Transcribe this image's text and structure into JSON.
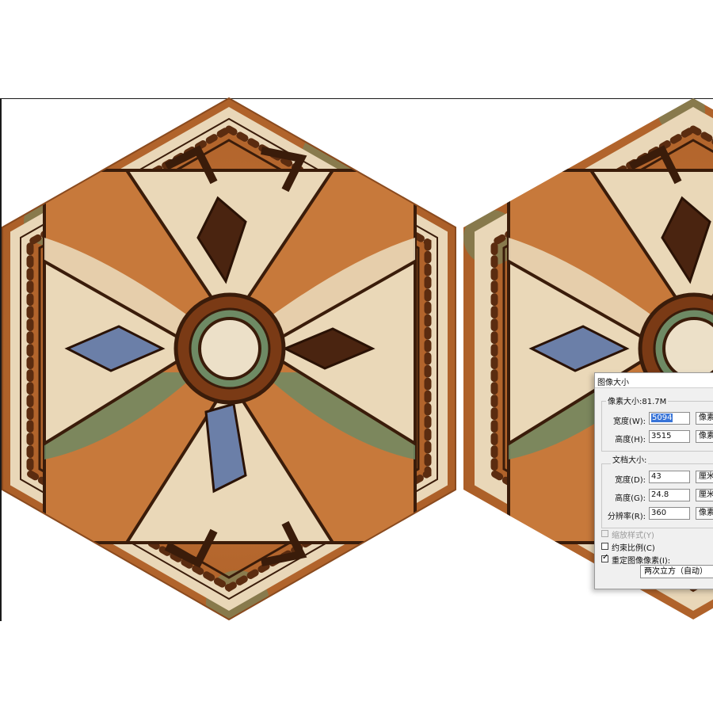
{
  "dialog": {
    "title": "图像大小",
    "pixel_dimensions": {
      "label": "像素大小:81.7M",
      "width_label": "宽度(W):",
      "width_value": "5094",
      "width_unit": "像素",
      "height_label": "高度(H):",
      "height_value": "3515",
      "height_unit": "像素"
    },
    "document_size": {
      "label": "文档大小:",
      "width_label": "宽度(D):",
      "width_value": "43",
      "width_unit": "厘米",
      "height_label": "高度(G):",
      "height_value": "24.8",
      "height_unit": "厘米",
      "resolution_label": "分辨率(R):",
      "resolution_value": "360",
      "resolution_unit": "像素"
    },
    "scale_styles": {
      "label": "缩放样式(Y)",
      "checked": false,
      "enabled": false
    },
    "constrain_proportions": {
      "label": "约束比例(C)",
      "checked": false
    },
    "resample_image": {
      "label": "重定图像像素(I):",
      "checked": true
    },
    "resample_method": "两次立方（自动）"
  },
  "colors": {
    "tile_orange": "#b8652a",
    "tile_cream": "#e9d7b8",
    "tile_brown": "#4a2410",
    "tile_green": "#6e8a64",
    "tile_blue": "#6b7fa8",
    "selection_blue": "#3874d8"
  }
}
